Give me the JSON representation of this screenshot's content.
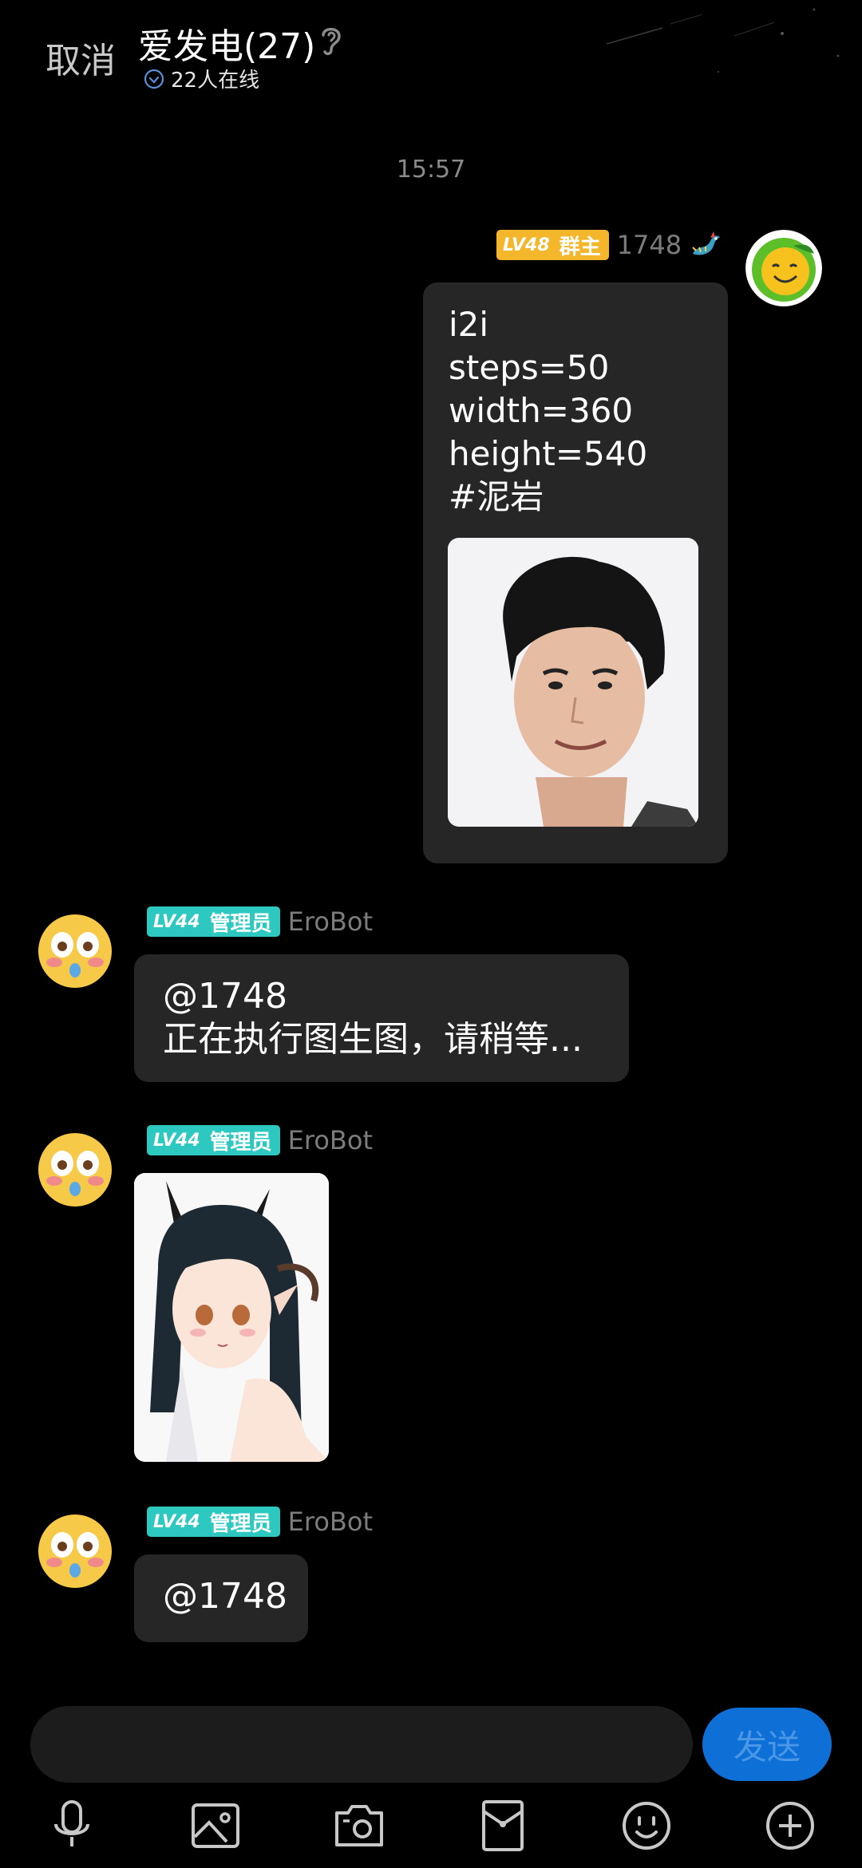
{
  "header": {
    "cancel_label": "取消",
    "title": "爱发电(27)",
    "online_text": "22人在线",
    "ear_icon": "ear-icon"
  },
  "timestamp": "15:57",
  "messages": [
    {
      "side": "right",
      "badge": {
        "level": "LV48",
        "role": "群主",
        "color": "#f4b62a"
      },
      "sender": "1748",
      "text": "i2i\nsteps=50\nwidth=360\nheight=540\n#泥岩"
    },
    {
      "side": "left",
      "badge": {
        "level": "LV44",
        "role": "管理员",
        "color": "#2dc8c0"
      },
      "sender": "EroBot",
      "text": "@1748\n 正在执行图生图，请稍等..."
    },
    {
      "side": "left",
      "badge": {
        "level": "LV44",
        "role": "管理员",
        "color": "#2dc8c0"
      },
      "sender": "EroBot"
    },
    {
      "side": "left",
      "badge": {
        "level": "LV44",
        "role": "管理员",
        "color": "#2dc8c0"
      },
      "sender": "EroBot",
      "text": "@1748"
    }
  ],
  "composer": {
    "send_label": "发送",
    "send_color": "#0e6fd6"
  },
  "toolbar_icons": [
    "microphone-icon",
    "image-icon",
    "camera-icon",
    "red-packet-icon",
    "emoji-icon",
    "plus-icon"
  ]
}
